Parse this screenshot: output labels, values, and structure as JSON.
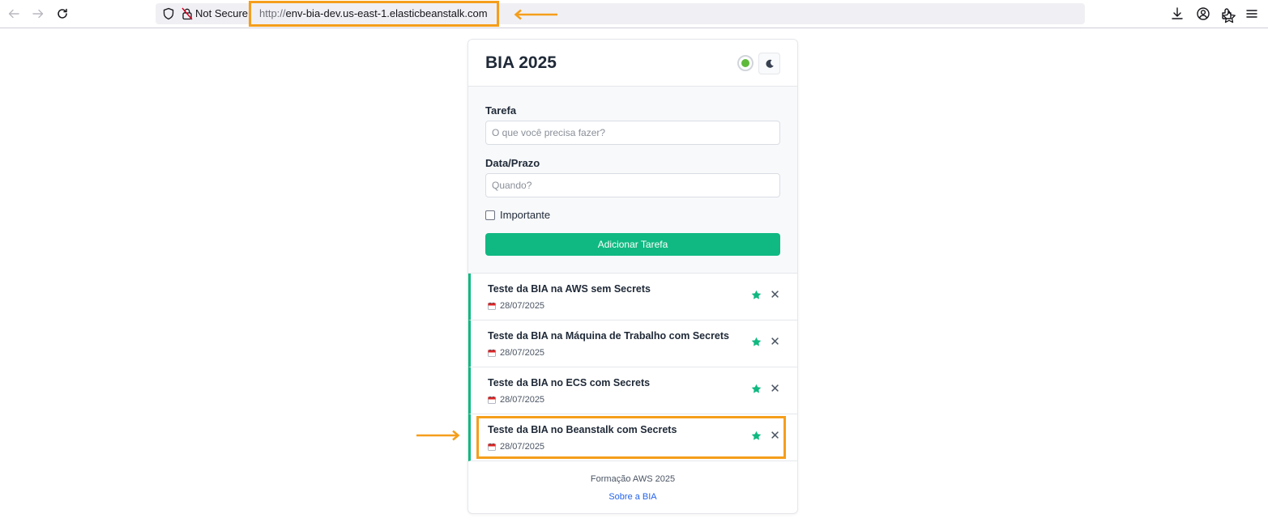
{
  "browser": {
    "security_label": "Not Secure",
    "url_protocol": "http://",
    "url_host": "env-bia-dev.us-east-1.elasticbeanstalk.com",
    "accent_color": "#f59e1b"
  },
  "app": {
    "title": "BIA 2025",
    "status_color": "#5fba3c",
    "theme_toggle_icon": "moon-icon"
  },
  "form": {
    "task_label": "Tarefa",
    "task_placeholder": "O que você precisa fazer?",
    "date_label": "Data/Prazo",
    "date_placeholder": "Quando?",
    "important_label": "Importante",
    "submit_label": "Adicionar Tarefa",
    "accent_color": "#10b981"
  },
  "tasks": [
    {
      "title": "Teste da BIA na AWS sem Secrets",
      "date": "28/07/2025"
    },
    {
      "title": "Teste da BIA na Máquina de Trabalho com Secrets",
      "date": "28/07/2025"
    },
    {
      "title": "Teste da BIA no ECS com Secrets",
      "date": "28/07/2025"
    },
    {
      "title": "Teste da BIA no Beanstalk com Secrets",
      "date": "28/07/2025"
    }
  ],
  "footer": {
    "text": "Formação AWS 2025",
    "link": "Sobre a BIA"
  }
}
